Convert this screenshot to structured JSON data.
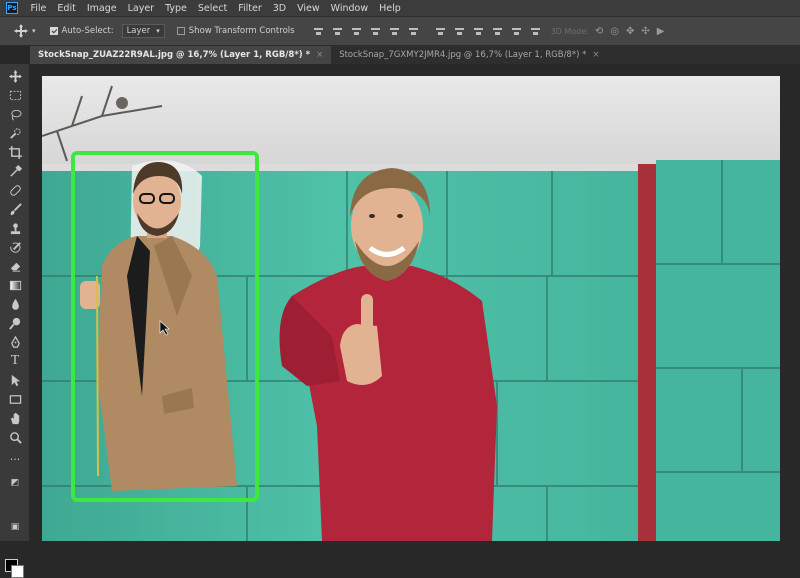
{
  "app_logo": "Ps",
  "menu": [
    "File",
    "Edit",
    "Image",
    "Layer",
    "Type",
    "Select",
    "Filter",
    "3D",
    "View",
    "Window",
    "Help"
  ],
  "options": {
    "auto_select_label": "Auto-Select:",
    "auto_select_value": "Layer",
    "show_transform_label": "Show Transform Controls",
    "mode_label": "3D Mode:"
  },
  "tabs": [
    {
      "label": "StockSnap_ZUAZ22R9AL.jpg @ 16,7% (Layer 1, RGB/8*) *",
      "close": "×",
      "active": true
    },
    {
      "label": "StockSnap_7GXMY2JMR4.jpg @ 16,7% (Layer 1, RGB/8*) *",
      "close": "×",
      "active": false
    }
  ],
  "tools": [
    "move-tool",
    "marquee-tool",
    "lasso-tool",
    "quick-select-tool",
    "crop-tool",
    "eyedropper-tool",
    "healing-brush-tool",
    "brush-tool",
    "clone-stamp-tool",
    "history-brush-tool",
    "eraser-tool",
    "gradient-tool",
    "blur-tool",
    "dodge-tool",
    "pen-tool",
    "type-tool",
    "path-selection-tool",
    "rectangle-tool",
    "hand-tool",
    "zoom-tool",
    "more-tools"
  ],
  "type_tool_glyph": "T",
  "more_tools_glyph": "...",
  "colors": {
    "accent": "#31a8ff",
    "selection": "#3ee83e",
    "wall": "#49bca3",
    "sweater": "#b2253a",
    "coat": "#b08a62"
  }
}
